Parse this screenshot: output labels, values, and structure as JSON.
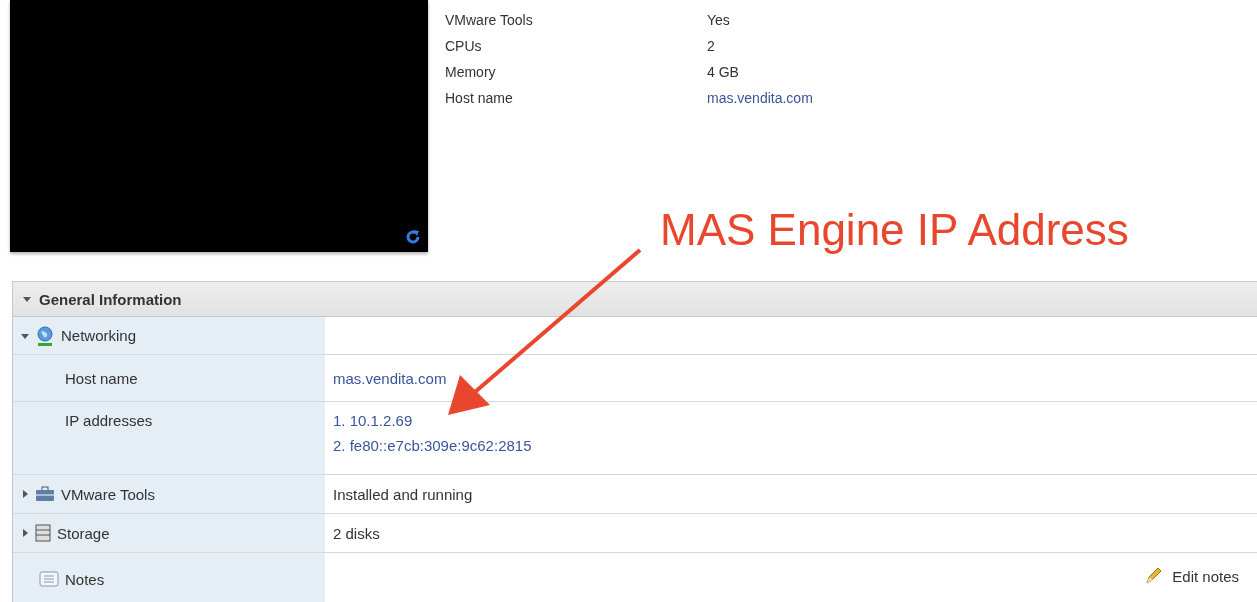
{
  "summary": [
    {
      "label": "VMware Tools",
      "value": "Yes",
      "link": false
    },
    {
      "label": "CPUs",
      "value": "2",
      "link": false
    },
    {
      "label": "Memory",
      "value": "4 GB",
      "link": false
    },
    {
      "label": "Host name",
      "value": "mas.vendita.com",
      "link": true
    }
  ],
  "annotation": "MAS Engine IP Address",
  "panel": {
    "title": "General Information",
    "expanded": true,
    "rows": [
      {
        "kind": "network",
        "label": "Networking",
        "expanded": true,
        "children": [
          {
            "label": "Host name",
            "values": [
              "mas.vendita.com"
            ]
          },
          {
            "label": "IP addresses",
            "values": [
              "1. 10.1.2.69",
              "2. fe80::e7cb:309e:9c62:2815"
            ]
          }
        ]
      },
      {
        "kind": "tools",
        "label": "VMware Tools",
        "expanded": false,
        "value": "Installed and running"
      },
      {
        "kind": "storage",
        "label": "Storage",
        "expanded": false,
        "value": "2 disks"
      },
      {
        "kind": "notes",
        "label": "Notes",
        "action": "Edit notes"
      }
    ]
  }
}
